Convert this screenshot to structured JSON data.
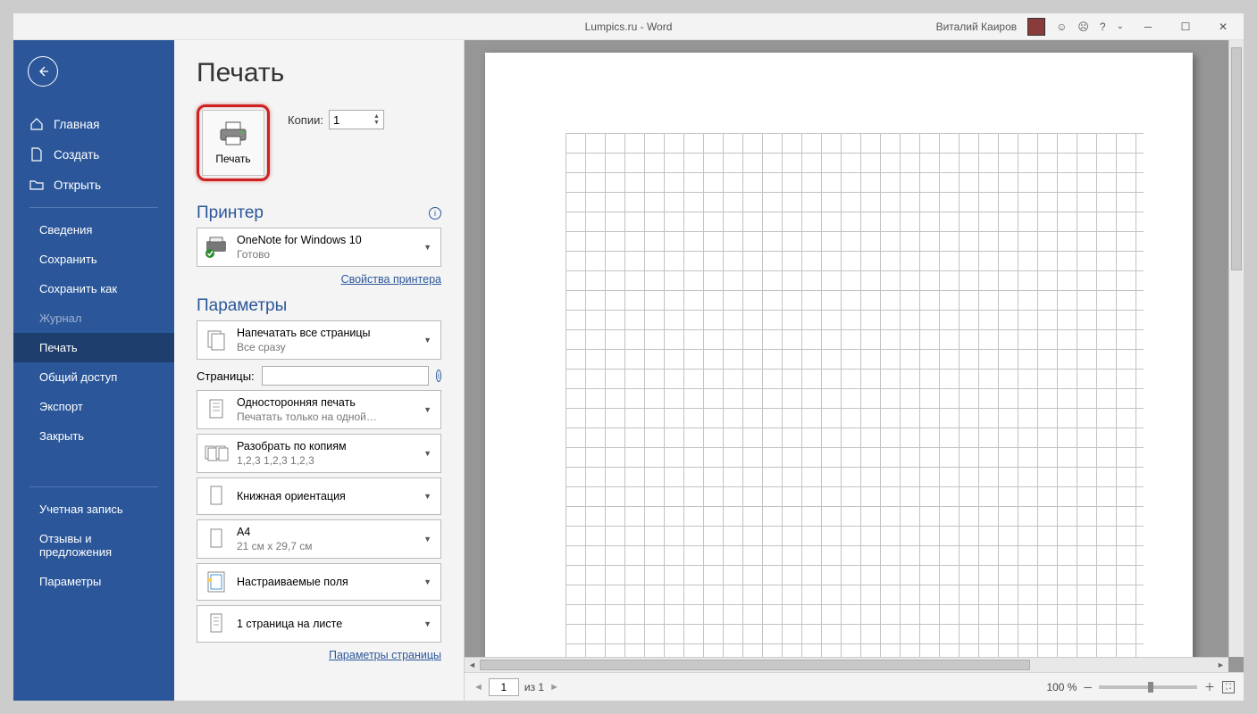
{
  "title_bar": {
    "title": "Lumpics.ru  -  Word",
    "user": "Виталий Каиров"
  },
  "sidebar": {
    "items": [
      {
        "label": "Главная",
        "icon": "home"
      },
      {
        "label": "Создать",
        "icon": "new"
      },
      {
        "label": "Открыть",
        "icon": "open"
      }
    ],
    "items2": [
      {
        "label": "Сведения"
      },
      {
        "label": "Сохранить"
      },
      {
        "label": "Сохранить как"
      },
      {
        "label": "Журнал",
        "disabled": true
      },
      {
        "label": "Печать",
        "selected": true
      },
      {
        "label": "Общий доступ"
      },
      {
        "label": "Экспорт"
      },
      {
        "label": "Закрыть"
      }
    ],
    "items3": [
      {
        "label": "Учетная запись"
      },
      {
        "label": "Отзывы и предложения"
      },
      {
        "label": "Параметры"
      }
    ]
  },
  "print": {
    "page_title": "Печать",
    "button": "Печать",
    "copies_label": "Копии:",
    "copies_value": "1",
    "printer_title": "Принтер",
    "printer_name": "OneNote for Windows 10",
    "printer_status": "Готово",
    "printer_props": "Свойства принтера",
    "settings_title": "Параметры",
    "opt_pages_title": "Напечатать все страницы",
    "opt_pages_sub": "Все сразу",
    "pages_label": "Страницы:",
    "opt_sides_title": "Односторонняя печать",
    "opt_sides_sub": "Печатать только на одной…",
    "opt_collate_title": "Разобрать по копиям",
    "opt_collate_sub": "1,2,3    1,2,3    1,2,3",
    "opt_orient_title": "Книжная ориентация",
    "opt_size_title": "A4",
    "opt_size_sub": "21 см x 29,7 см",
    "opt_margins_title": "Настраиваемые поля",
    "opt_perpage_title": "1 страница на листе",
    "page_setup": "Параметры страницы"
  },
  "footer": {
    "page_current": "1",
    "page_of": "из 1",
    "zoom": "100 %"
  }
}
